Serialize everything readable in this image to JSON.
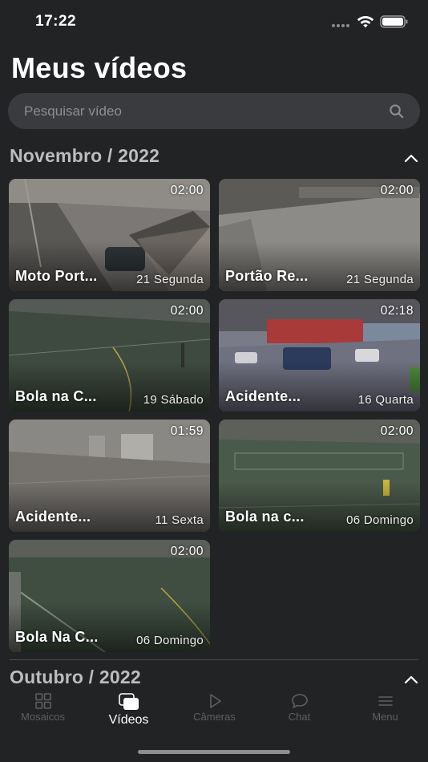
{
  "status_bar": {
    "time": "17:22"
  },
  "page": {
    "title": "Meus vídeos"
  },
  "search": {
    "placeholder": "Pesquisar vídeo"
  },
  "sections": [
    {
      "title": "Novembro / 2022"
    },
    {
      "title": "Outubro / 2022"
    }
  ],
  "videos": [
    {
      "title": "Moto Port...",
      "duration": "02:00",
      "date": "21 Segunda"
    },
    {
      "title": "Portão Re...",
      "duration": "02:00",
      "date": "21 Segunda"
    },
    {
      "title": "Bola na C...",
      "duration": "02:00",
      "date": "19 Sábado"
    },
    {
      "title": "Acidente...",
      "duration": "02:18",
      "date": "16 Quarta"
    },
    {
      "title": "Acidente...",
      "duration": "01:59",
      "date": "11 Sexta"
    },
    {
      "title": "Bola na c...",
      "duration": "02:00",
      "date": "06 Domingo"
    },
    {
      "title": "Bola Na C...",
      "duration": "02:00",
      "date": "06 Domingo"
    }
  ],
  "tabs": [
    {
      "label": "Mosaicos",
      "icon": "grid-icon"
    },
    {
      "label": "Vídeos",
      "icon": "videos-icon",
      "active": true
    },
    {
      "label": "Câmeras",
      "icon": "play-icon"
    },
    {
      "label": "Chat",
      "icon": "chat-bubble-icon"
    },
    {
      "label": "Menu",
      "icon": "menu-icon"
    }
  ],
  "colors": {
    "background": "#222325",
    "search_background": "#3a3b3e",
    "section_title": "#bdbdbf",
    "tab_inactive": "#5e5f62",
    "tab_active": "#ffffff"
  }
}
